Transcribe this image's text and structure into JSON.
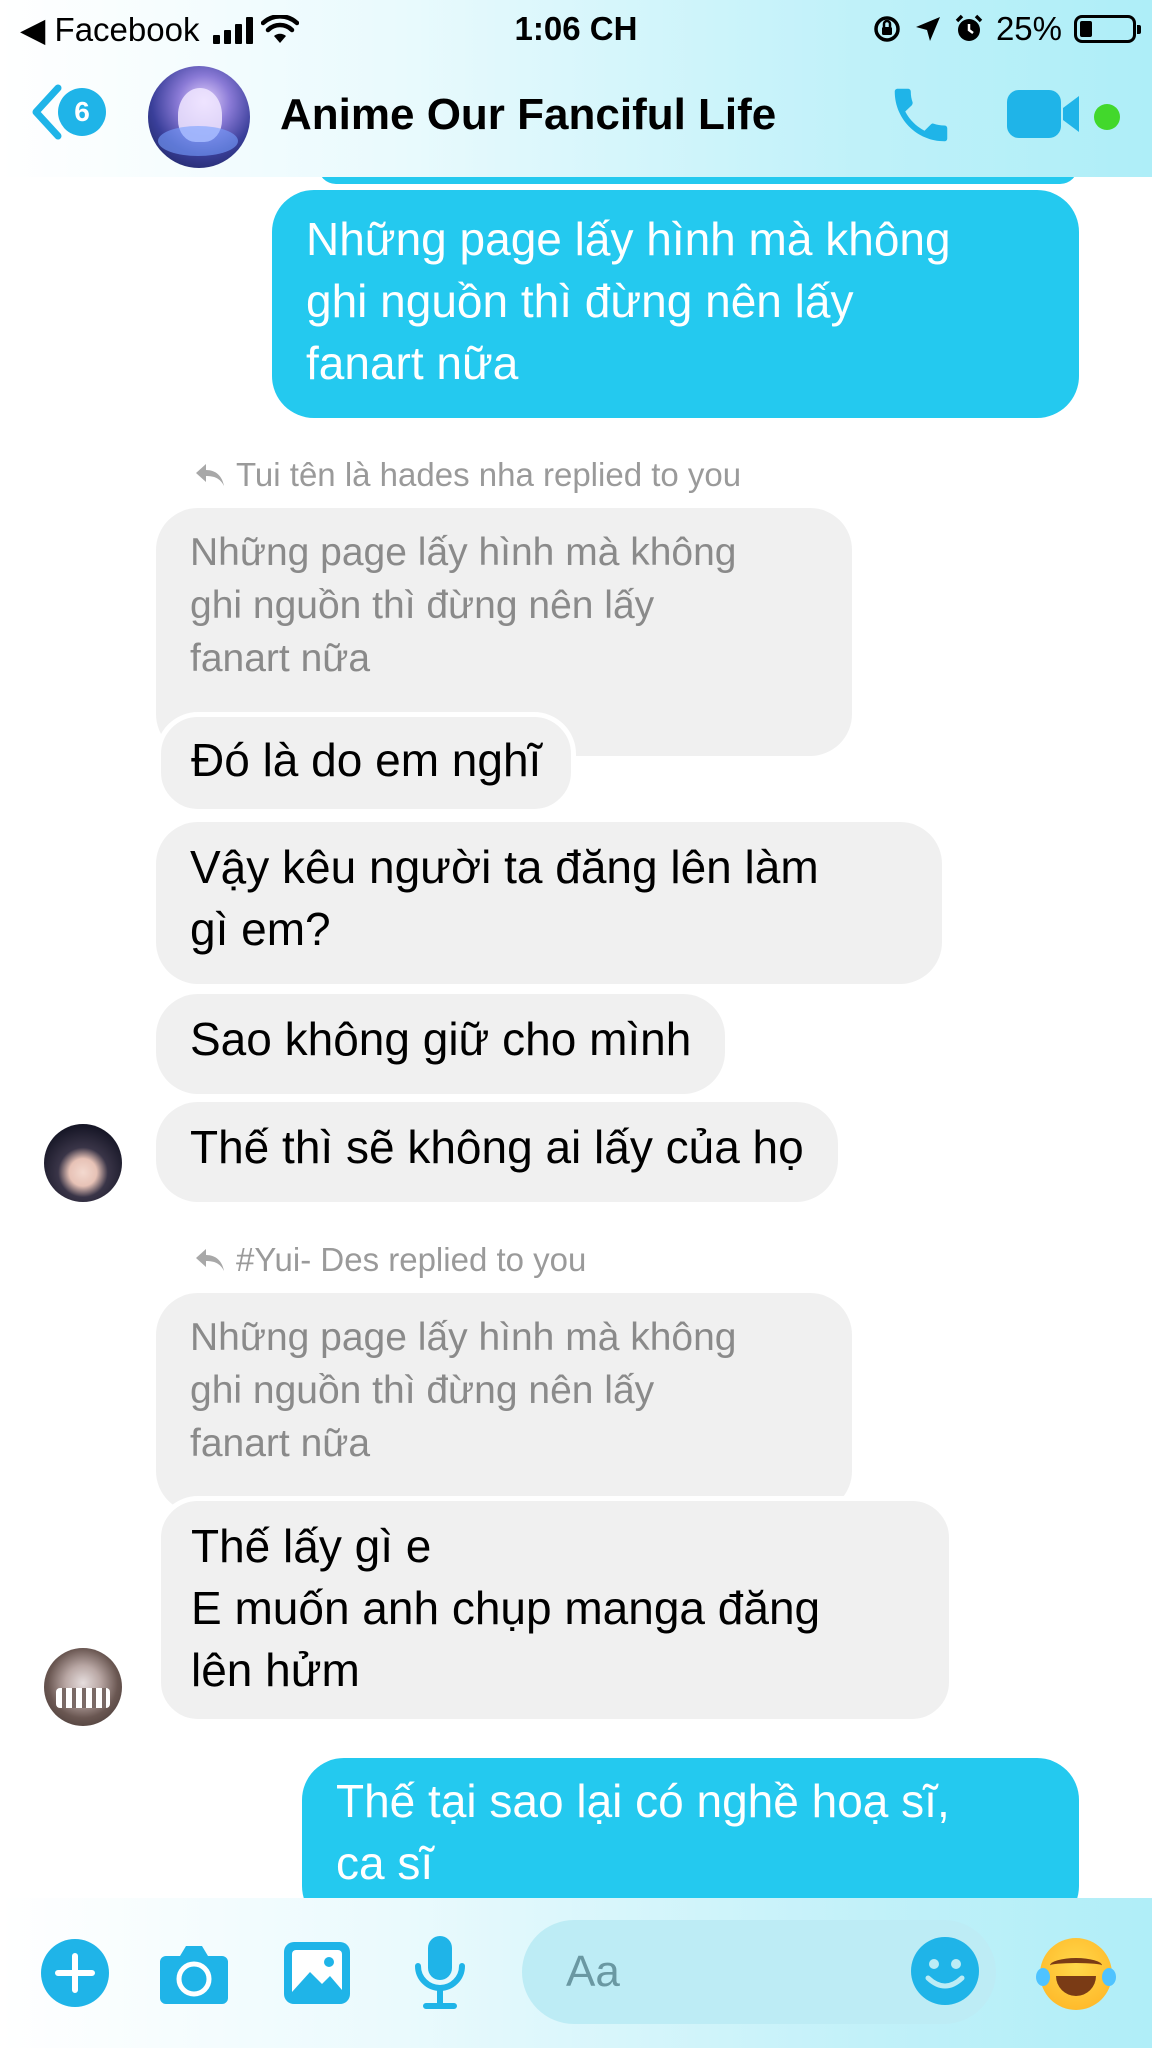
{
  "status_bar": {
    "back_app": "◀ Facebook",
    "time": "1:06 CH",
    "battery": "25%"
  },
  "header": {
    "back_badge": "6",
    "chat_title": "Anime Our Fanciful Life"
  },
  "messages": {
    "out_1": [
      "Những page lấy hình mà không",
      "ghi nguồn thì đừng nên lấy",
      "fanart nữa"
    ],
    "reply_1": {
      "note": "Tui tên là hades nha replied to you",
      "quote": [
        "Những page lấy hình mà không",
        "ghi nguồn thì đừng nên lấy",
        "fanart nữa"
      ],
      "msg_1": "Đó là do em nghĩ",
      "msg_2": [
        "Vậy kêu người ta đăng lên làm",
        "gì em?"
      ],
      "msg_3": "Sao không giữ cho mình",
      "msg_4": "Thế thì sẽ không ai lấy của họ"
    },
    "reply_2": {
      "note": "#Yui- Des replied to you",
      "quote": [
        "Những page lấy hình mà không",
        "ghi nguồn thì đừng nên lấy",
        "fanart nữa"
      ],
      "msg_1": [
        "Thế lấy gì e",
        "E muốn anh chụp manga đăng",
        "lên hửm"
      ]
    },
    "out_2": [
      "Thế tại sao lại có nghề hoạ sĩ,",
      "ca sĩ"
    ]
  },
  "composer": {
    "placeholder": "Aa"
  },
  "colors": {
    "accent": "#1fb4e8",
    "outgoing_bubble": "#24c9ef",
    "incoming_bubble": "#f0f0f0",
    "online": "#42d82c"
  },
  "icons": [
    "back-chevron-icon",
    "phone-icon",
    "video-camera-icon",
    "plus-icon",
    "camera-icon",
    "image-icon",
    "microphone-icon",
    "emoji-smile-icon",
    "laughing-emoji-icon",
    "reply-arrow-icon",
    "signal-icon",
    "wifi-icon",
    "location-icon",
    "alarm-icon",
    "rotation-lock-icon",
    "battery-icon"
  ]
}
